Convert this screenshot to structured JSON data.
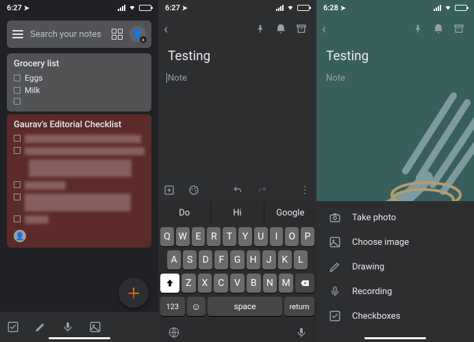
{
  "screen1": {
    "time": "6:27",
    "search_placeholder": "Search your notes",
    "notes": [
      {
        "title": "Grocery list",
        "items": [
          "Eggs",
          "Milk",
          ""
        ]
      },
      {
        "title": "Gaurav's Editorial Checklist"
      }
    ]
  },
  "screen2": {
    "time": "6:27",
    "title": "Testing",
    "body_placeholder": "Note",
    "suggestions": [
      "Do",
      "Hi",
      "Google"
    ],
    "keyboard": {
      "row1": [
        "Q",
        "W",
        "E",
        "R",
        "T",
        "Y",
        "U",
        "I",
        "O",
        "P"
      ],
      "row2": [
        "A",
        "S",
        "D",
        "F",
        "G",
        "H",
        "J",
        "K",
        "L"
      ],
      "row3": [
        "Z",
        "X",
        "C",
        "V",
        "B",
        "N",
        "M"
      ],
      "num_key": "123",
      "space": "space",
      "return": "return"
    }
  },
  "screen3": {
    "time": "6:28",
    "title": "Testing",
    "body_placeholder": "Note",
    "sheet_items": [
      {
        "icon": "camera-icon",
        "label": "Take photo"
      },
      {
        "icon": "image-icon",
        "label": "Choose image"
      },
      {
        "icon": "brush-icon",
        "label": "Drawing"
      },
      {
        "icon": "mic-icon",
        "label": "Recording"
      },
      {
        "icon": "checkbox-icon",
        "label": "Checkboxes"
      }
    ]
  }
}
